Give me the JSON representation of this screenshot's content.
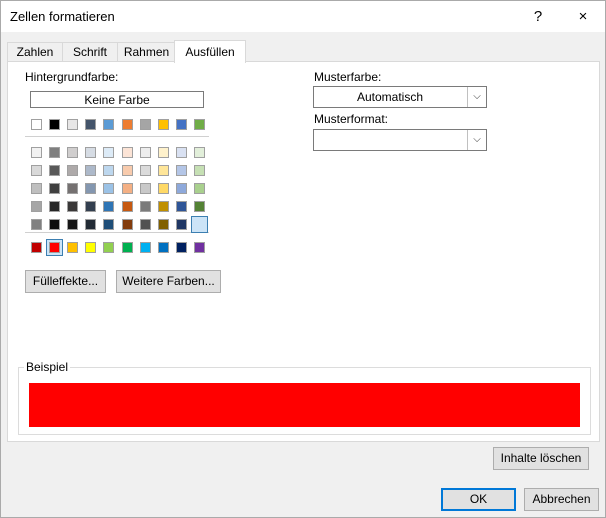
{
  "window": {
    "title": "Zellen formatieren",
    "help": "?",
    "close": "×"
  },
  "tabs": [
    {
      "label": "Zahlen"
    },
    {
      "label": "Schrift"
    },
    {
      "label": "Rahmen"
    },
    {
      "label": "Ausfüllen",
      "active": true
    }
  ],
  "background": {
    "label": "Hintergrundfarbe:",
    "no_color": "Keine Farbe",
    "theme_row": [
      "#ffffff",
      "#000000",
      "#e7e6e6",
      "#44546a",
      "#5b9bd5",
      "#ed7d31",
      "#a5a5a5",
      "#ffc000",
      "#4472c4",
      "#70ad47"
    ],
    "tint_rows": [
      [
        "#f2f2f2",
        "#7f7f7f",
        "#d0cece",
        "#d6dce4",
        "#ddebf7",
        "#fce4d6",
        "#ededed",
        "#fff2cc",
        "#d9e1f2",
        "#e2efda"
      ],
      [
        "#d9d9d9",
        "#595959",
        "#aeaaaa",
        "#adb9ca",
        "#bdd7ee",
        "#f8cbad",
        "#dbdbdb",
        "#ffe699",
        "#b4c6e7",
        "#c6e0b4"
      ],
      [
        "#bfbfbf",
        "#404040",
        "#757171",
        "#8497b0",
        "#9bc2e6",
        "#f4b084",
        "#c9c9c9",
        "#ffd966",
        "#8ea9db",
        "#a9d08e"
      ],
      [
        "#a6a6a6",
        "#262626",
        "#3a3838",
        "#333f4f",
        "#2f75b5",
        "#c65911",
        "#7b7b7b",
        "#bf8f00",
        "#2f5597",
        "#548235"
      ],
      [
        "#808080",
        "#0d0d0d",
        "#161616",
        "#222b35",
        "#1f4e78",
        "#833c0c",
        "#525252",
        "#806000",
        "#203764",
        "#375623"
      ]
    ],
    "standard_row": [
      "#c00000",
      "#ff0000",
      "#ffc000",
      "#ffff00",
      "#92d050",
      "#00b050",
      "#00b0f0",
      "#0070c0",
      "#002060",
      "#7030a0"
    ],
    "fill_effects": "Fülleffekte...",
    "more_colors": "Weitere Farben..."
  },
  "pattern": {
    "color_label": "Musterfarbe:",
    "color_value": "Automatisch",
    "style_label": "Musterformat:",
    "style_value": ""
  },
  "sample": {
    "label": "Beispiel",
    "color": "#ff0000"
  },
  "buttons": {
    "clear": "Inhalte löschen",
    "ok": "OK",
    "cancel": "Abbrechen"
  }
}
